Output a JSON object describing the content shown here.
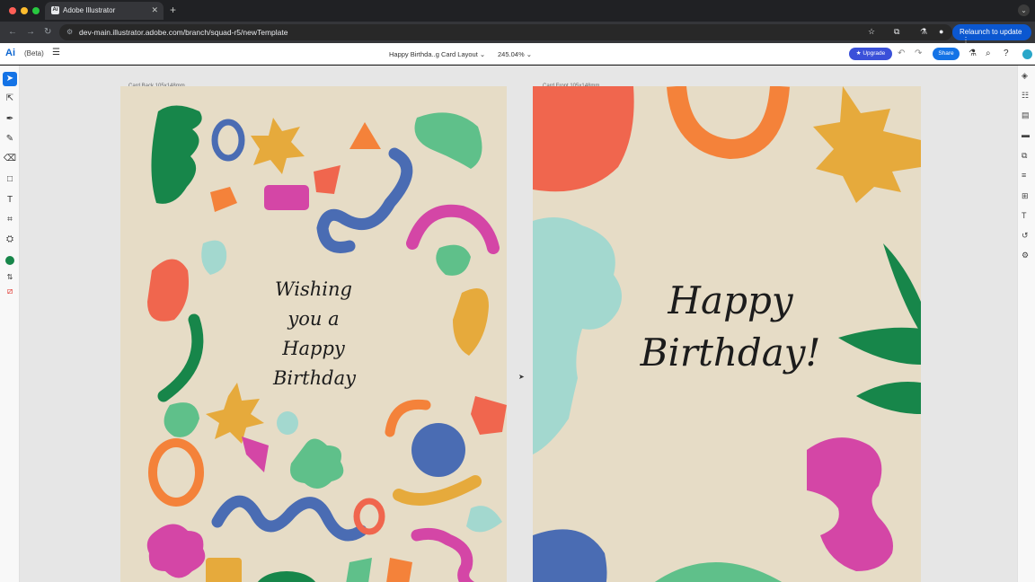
{
  "browser": {
    "tab_title": "Adobe Illustrator",
    "tab_favicon": "Ai",
    "new_tab_icon": "+",
    "url": "dev-main.illustrator.adobe.com/branch/squad-r5/newTemplate",
    "relaunch_label": "Relaunch to update"
  },
  "app": {
    "logo": "Ai",
    "beta_label": "(Beta)",
    "document_title": "Happy Birthda..g Card Layout",
    "zoom_level": "245.04%",
    "upgrade_label": "Upgrade",
    "share_label": "Share"
  },
  "artboards": {
    "back_label": "Card Back 105x148mm",
    "front_label": "Card Front 105x148mm"
  },
  "card_back": {
    "line1": "Wishing",
    "line2": "you a",
    "line3": "Happy",
    "line4": "Birthday"
  },
  "card_front": {
    "line1": "Happy",
    "line2": "Birthday!"
  },
  "colors": {
    "green": "#17864a",
    "light_green": "#5fc08a",
    "orange": "#f4823a",
    "red": "#f0664e",
    "yellow": "#e6aa3c",
    "pink": "#d446a6",
    "blue": "#4a6cb3",
    "teal": "#a3d8cf",
    "card_bg": "#e6dcc6"
  }
}
